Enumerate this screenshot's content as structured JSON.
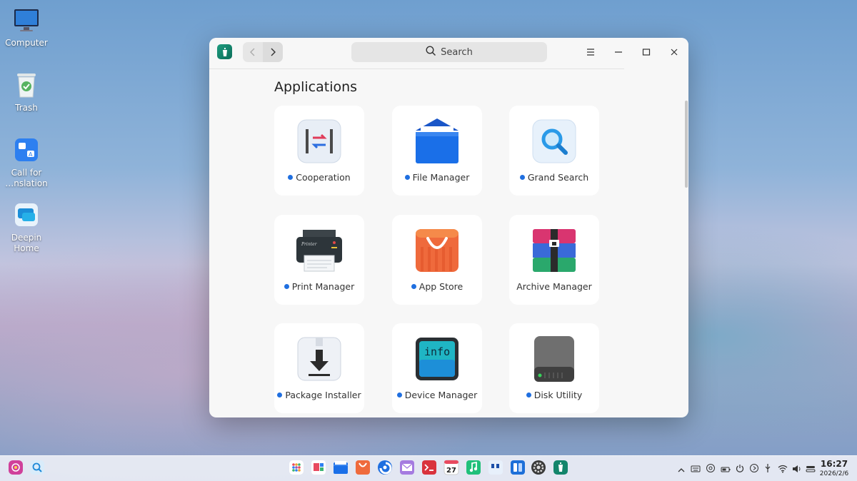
{
  "desktop": {
    "icons": [
      {
        "label": "Computer"
      },
      {
        "label": "Trash"
      },
      {
        "label": "Call for\n…nslation"
      },
      {
        "label": "Deepin\nHome"
      }
    ]
  },
  "window": {
    "search": {
      "label": "Search"
    },
    "section_title": "Applications",
    "apps": [
      {
        "label": "Cooperation",
        "new": true,
        "icon": "cooperation-icon"
      },
      {
        "label": "File Manager",
        "new": true,
        "icon": "file-manager-icon"
      },
      {
        "label": "Grand Search",
        "new": true,
        "icon": "grand-search-icon"
      },
      {
        "label": "Print Manager",
        "new": true,
        "icon": "print-manager-icon"
      },
      {
        "label": "App Store",
        "new": true,
        "icon": "app-store-icon"
      },
      {
        "label": "Archive Manager",
        "new": false,
        "icon": "archive-manager-icon"
      },
      {
        "label": "Package Installer",
        "new": true,
        "icon": "package-installer-icon"
      },
      {
        "label": "Device Manager",
        "new": true,
        "icon": "device-manager-icon"
      },
      {
        "label": "Disk Utility",
        "new": true,
        "icon": "disk-utility-icon"
      }
    ],
    "device_manager_icon_text": "info",
    "printer_icon_text": "Printer"
  },
  "taskbar": {
    "calendar_day": "27",
    "clock": {
      "time": "16:27",
      "date": "2026/2/6"
    }
  },
  "colors": {
    "accent": "#1f6fe0",
    "window_bg": "#f7f7f7",
    "card_bg": "#ffffff"
  }
}
